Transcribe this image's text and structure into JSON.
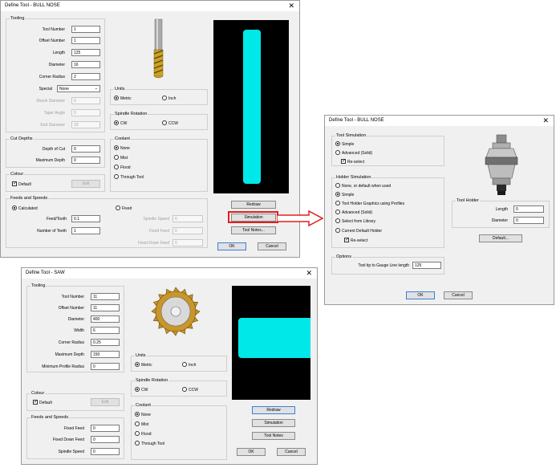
{
  "bull": {
    "title": "Define Tool - BULL NOSE",
    "tooling": {
      "label": "Tooling",
      "tool_number": {
        "label": "Tool Number",
        "value": "1"
      },
      "offset_number": {
        "label": "Offset Number",
        "value": "1"
      },
      "length": {
        "label": "Length",
        "value": "125"
      },
      "diameter": {
        "label": "Diameter",
        "value": "16"
      },
      "corner_radius": {
        "label": "Corner Radius",
        "value": "2"
      },
      "special": {
        "label": "Special",
        "value": "None"
      },
      "shank_diameter": {
        "label": "Shank Diameter",
        "value": "0"
      },
      "taper_angle": {
        "label": "Taper Angle",
        "value": "5"
      },
      "end_diameter": {
        "label": "End Diameter",
        "value": "10"
      }
    },
    "cut_depths": {
      "label": "Cut Depths",
      "depth_of_cut": {
        "label": "Depth of Cut",
        "value": "0"
      },
      "maximum_depth": {
        "label": "Maximum Depth",
        "value": "0"
      }
    },
    "colour": {
      "label": "Colour",
      "default_label": "Default",
      "edit": "Edit"
    },
    "feeds": {
      "label": "Feeds and Speeds",
      "calculated": "Calculated",
      "fixed": "Fixed",
      "feed_tooth": {
        "label": "Feed/Tooth",
        "value": "0.1"
      },
      "teeth": {
        "label": "Number of Teeth",
        "value": "1"
      },
      "spindle_speed": {
        "label": "Spindle Speed",
        "value": "0"
      },
      "fixed_feed": {
        "label": "Fixed Feed",
        "value": "0"
      },
      "fixed_down_feed": {
        "label": "Fixed Down Feed",
        "value": "0"
      }
    },
    "units": {
      "label": "Units",
      "metric": "Metric",
      "inch": "Inch"
    },
    "spindle": {
      "label": "Spindle Rotation",
      "cw": "CW",
      "ccw": "CCW"
    },
    "coolant": {
      "label": "Coolant",
      "none": "None",
      "mist": "Mist",
      "flood": "Flood",
      "through": "Through Tool"
    },
    "buttons": {
      "redraw": "Redraw",
      "simulation": "Simulation",
      "tool_notes": "Tool Notes...",
      "ok": "OK",
      "cancel": "Cancel"
    }
  },
  "holder": {
    "title": "Define Tool - BULL NOSE",
    "tool_sim": {
      "label": "Tool Simulation",
      "simple": "Simple",
      "advanced": "Advanced (Solid)",
      "reselect": "Re-select"
    },
    "holder_sim": {
      "label": "Holder Simulation",
      "none": "None, or default when used",
      "simple": "Simple",
      "profiles": "Tool Holder Graphics using Profiles",
      "advanced": "Advanced (Solid)",
      "library": "Select from Library",
      "current": "Current Default Holder",
      "reselect": "Re-select"
    },
    "tool_holder": {
      "label": "Tool Holder",
      "length": {
        "label": "Length",
        "value": "0"
      },
      "diameter": {
        "label": "Diameter",
        "value": "0"
      },
      "default_button": "Default..."
    },
    "options": {
      "label": "Options",
      "gauge": {
        "label": "Tool tip to Gauge Line length",
        "value": "125"
      }
    },
    "buttons": {
      "ok": "OK",
      "cancel": "Cancel"
    }
  },
  "saw": {
    "title": "Define Tool - SAW",
    "tooling": {
      "label": "Tooling",
      "tool_number": {
        "label": "Tool Number",
        "value": "11"
      },
      "offset_number": {
        "label": "Offset Number",
        "value": "11"
      },
      "diameter": {
        "label": "Diameter",
        "value": "400"
      },
      "width": {
        "label": "Width",
        "value": "6"
      },
      "corner_radius": {
        "label": "Corner Radius",
        "value": "0.25"
      },
      "maximum_depth": {
        "label": "Maximum Depth",
        "value": "150"
      },
      "min_profile_radius": {
        "label": "Minimum Profile Radius",
        "value": "0"
      }
    },
    "colour": {
      "label": "Colour",
      "default_label": "Default",
      "edit": "Edit"
    },
    "feeds": {
      "label": "Feeds and Speeds",
      "fixed_feed": {
        "label": "Fixed Feed",
        "value": "0"
      },
      "fixed_down_feed": {
        "label": "Fixed Down Feed",
        "value": "0"
      },
      "spindle_speed": {
        "label": "Spindle Speed",
        "value": "0"
      }
    },
    "units": {
      "label": "Units",
      "metric": "Metric",
      "inch": "Inch"
    },
    "spindle": {
      "label": "Spindle Rotation",
      "cw": "CW",
      "ccw": "CCW"
    },
    "coolant": {
      "label": "Coolant",
      "none": "None",
      "mist": "Mist",
      "flood": "Flood",
      "through": "Through Tool"
    },
    "buttons": {
      "redraw": "Redraw",
      "simulation": "Simulation",
      "tool_notes": "Tool Notes",
      "ok": "OK",
      "cancel": "Cancel"
    }
  },
  "colors": {
    "preview_bg": "#000000",
    "tool_cyan": "#00e8e8",
    "highlight": "#e0201c"
  }
}
